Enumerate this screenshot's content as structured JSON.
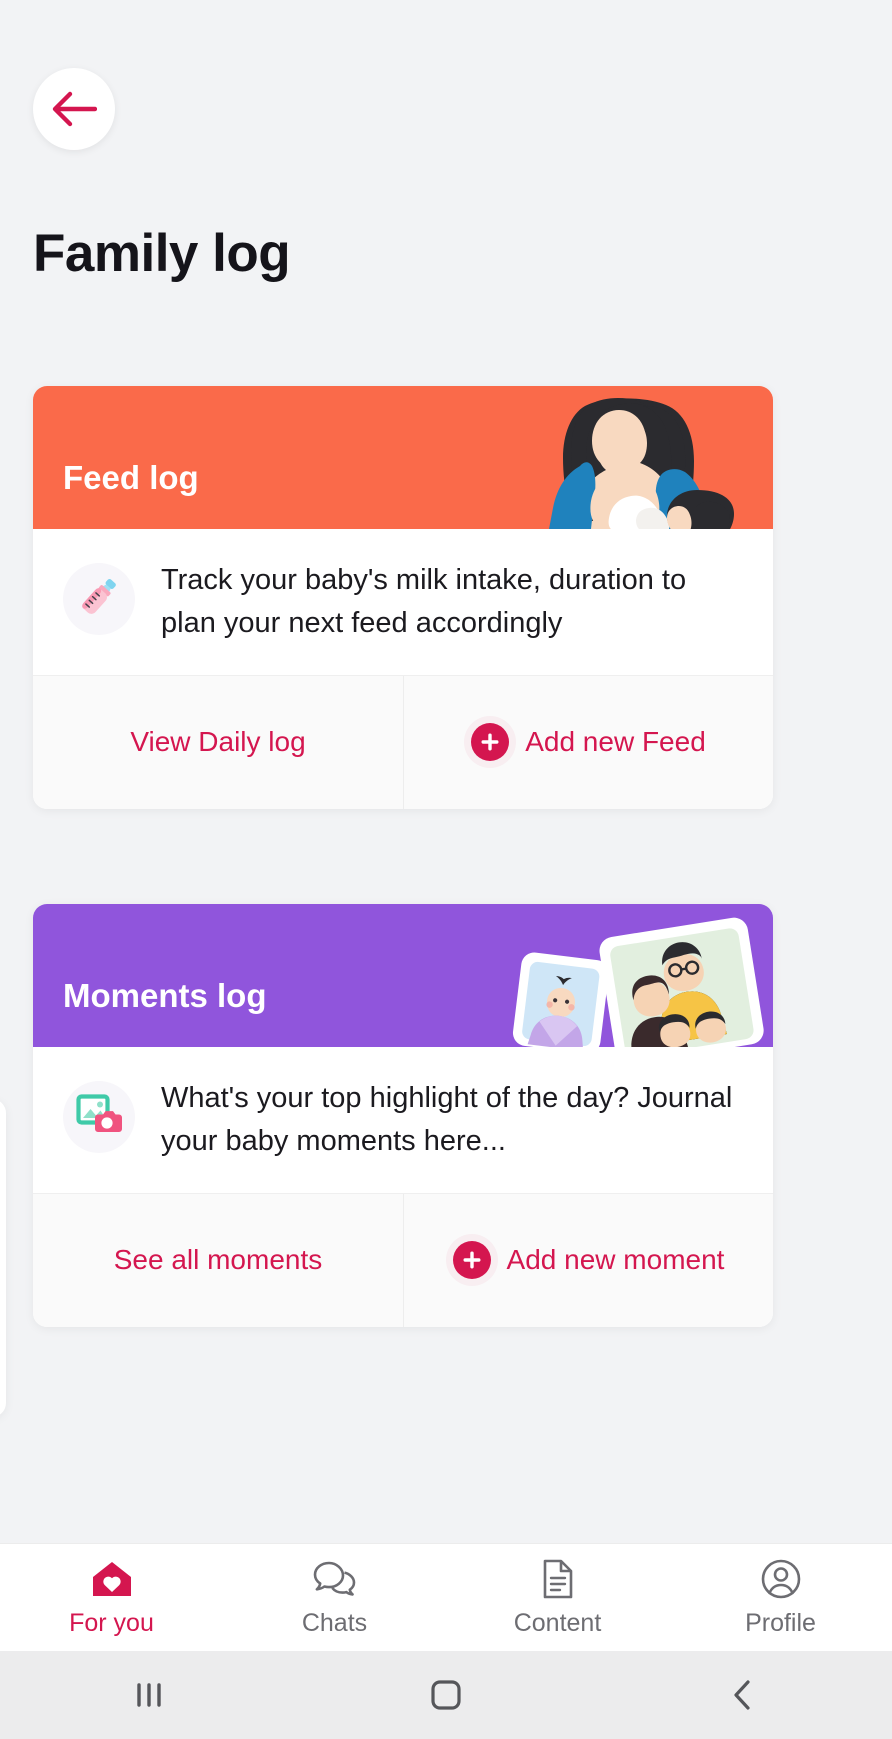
{
  "header": {
    "back_icon": "arrow-left-icon",
    "title": "Family log"
  },
  "theme": {
    "page_bg": "#f2f3f5",
    "accent": "#d4164f",
    "feed_banner": "#fa6a4a",
    "moments_banner": "#9055dc",
    "card_bg": "#ffffff",
    "action_bg": "#fafafa",
    "muted_text": "#6d6d72"
  },
  "cards": [
    {
      "id": "feed-log",
      "banner_title": "Feed log",
      "banner_color": "#fa6a4a",
      "banner_art": "breastfeeding-mother-illustration",
      "body_icon": "baby-bottle-icon",
      "body_text": "Track your baby's milk intake, duration to plan your next feed accordingly",
      "actions": [
        {
          "label": "View Daily log",
          "icon": null
        },
        {
          "label": "Add new Feed",
          "icon": "plus-circle-icon"
        }
      ]
    },
    {
      "id": "moments-log",
      "banner_title": "Moments log",
      "banner_color": "#9055dc",
      "banner_art": "family-photo-cards-illustration",
      "body_icon": "photo-camera-icon",
      "body_text": "What's your top highlight of the day? Journal your baby moments here...",
      "actions": [
        {
          "label": "See all moments",
          "icon": null
        },
        {
          "label": "Add new moment",
          "icon": "plus-circle-icon"
        }
      ]
    }
  ],
  "tabbar": {
    "tabs": [
      {
        "label": "For you",
        "icon": "home-heart-icon",
        "active": true
      },
      {
        "label": "Chats",
        "icon": "chat-bubbles-icon",
        "active": false
      },
      {
        "label": "Content",
        "icon": "document-icon",
        "active": false
      },
      {
        "label": "Profile",
        "icon": "user-circle-icon",
        "active": false
      }
    ]
  },
  "system_nav": {
    "buttons": [
      {
        "name": "recents",
        "icon": "recents-bars-icon"
      },
      {
        "name": "home",
        "icon": "home-square-icon"
      },
      {
        "name": "back",
        "icon": "chevron-left-icon"
      }
    ]
  }
}
